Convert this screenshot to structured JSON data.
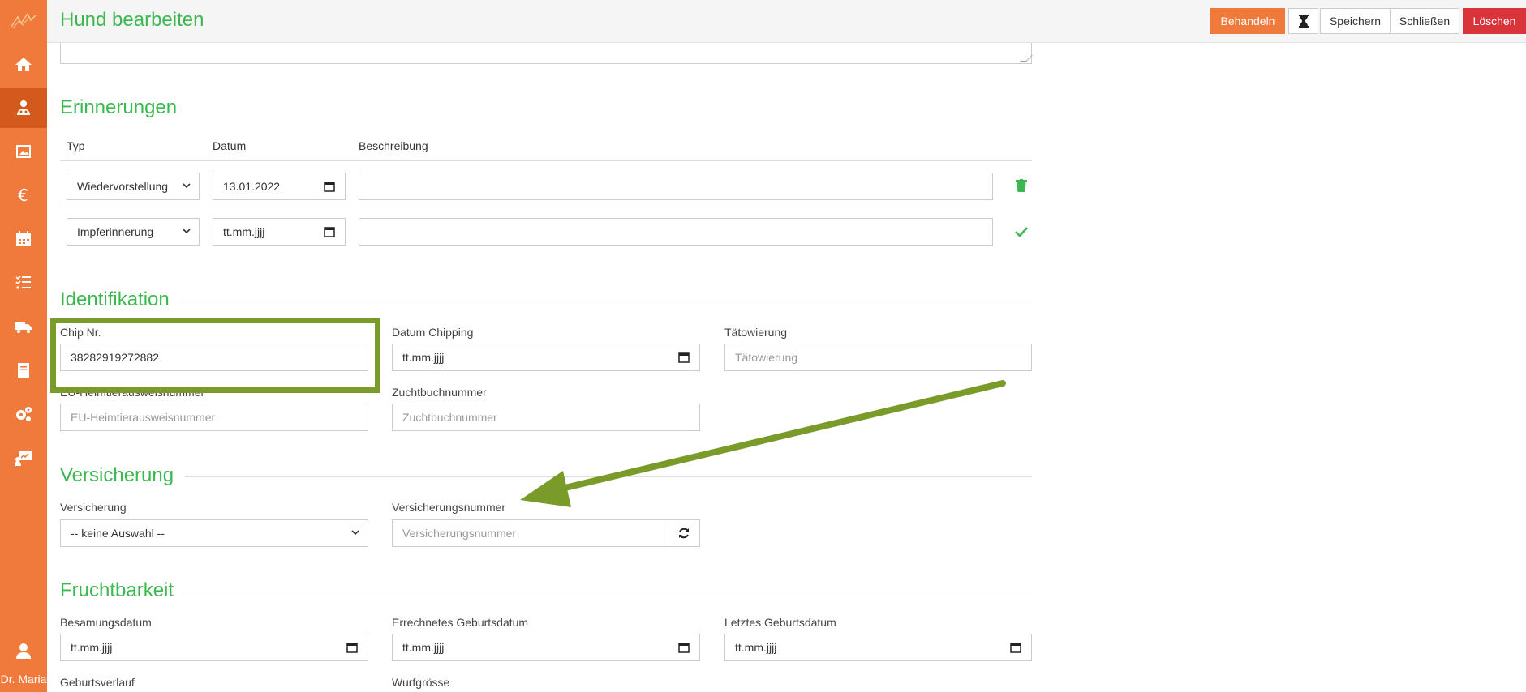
{
  "app": {
    "user_name": "Dr. Maria"
  },
  "header": {
    "title": "Hund bearbeiten",
    "buttons": {
      "behandeln": "Behandeln",
      "speichern": "Speichern",
      "schliessen": "Schließen",
      "loeschen": "Löschen"
    }
  },
  "sidebar": {
    "items": [
      {
        "icon": "home-icon"
      },
      {
        "icon": "patients-icon",
        "active": true
      },
      {
        "icon": "image-icon"
      },
      {
        "icon": "euro-icon"
      },
      {
        "icon": "calendar-icon"
      },
      {
        "icon": "tasks-icon"
      },
      {
        "icon": "truck-icon"
      },
      {
        "icon": "book-icon"
      },
      {
        "icon": "settings-icon"
      },
      {
        "icon": "statistics-icon"
      }
    ]
  },
  "erinnerungen": {
    "title": "Erinnerungen",
    "columns": {
      "typ": "Typ",
      "datum": "Datum",
      "beschreibung": "Beschreibung"
    },
    "rows": [
      {
        "typ": "Wiedervorstellung",
        "datum": "13.01.2022",
        "beschreibung": "",
        "action": "delete"
      },
      {
        "typ": "Impferinnerung",
        "datum": "tt.mm.jjjj",
        "beschreibung": "",
        "action": "confirm"
      }
    ]
  },
  "identifikation": {
    "title": "Identifikation",
    "chip_label": "Chip Nr.",
    "chip_value": "38282919272882",
    "chipping_label": "Datum Chipping",
    "chipping_value": "tt.mm.jjjj",
    "taetowierung_label": "Tätowierung",
    "taetowierung_placeholder": "Tätowierung",
    "eu_pass_label": "EU-Heimtierausweisnummer",
    "eu_pass_placeholder": "EU-Heimtierausweisnummer",
    "zuchtbuch_label": "Zuchtbuchnummer",
    "zuchtbuch_placeholder": "Zuchtbuchnummer"
  },
  "versicherung": {
    "title": "Versicherung",
    "insurer_label": "Versicherung",
    "insurer_value": "-- keine Auswahl --",
    "number_label": "Versicherungsnummer",
    "number_placeholder": "Versicherungsnummer"
  },
  "fruchtbarkeit": {
    "title": "Fruchtbarkeit",
    "besamung_label": "Besamungsdatum",
    "besamung_value": "tt.mm.jjjj",
    "errechnet_label": "Errechnetes Geburtsdatum",
    "errechnet_value": "tt.mm.jjjj",
    "letztes_label": "Letztes Geburtsdatum",
    "letztes_value": "tt.mm.jjjj",
    "geburtsverlauf_label": "Geburtsverlauf",
    "wurfgroesse_label": "Wurfgrösse"
  },
  "colors": {
    "sidebar": "#ef7a3c",
    "sidebar_active": "#d35a1c",
    "accent_green": "#3cb850",
    "danger": "#d9343a",
    "annotation": "#7a9a2a"
  }
}
